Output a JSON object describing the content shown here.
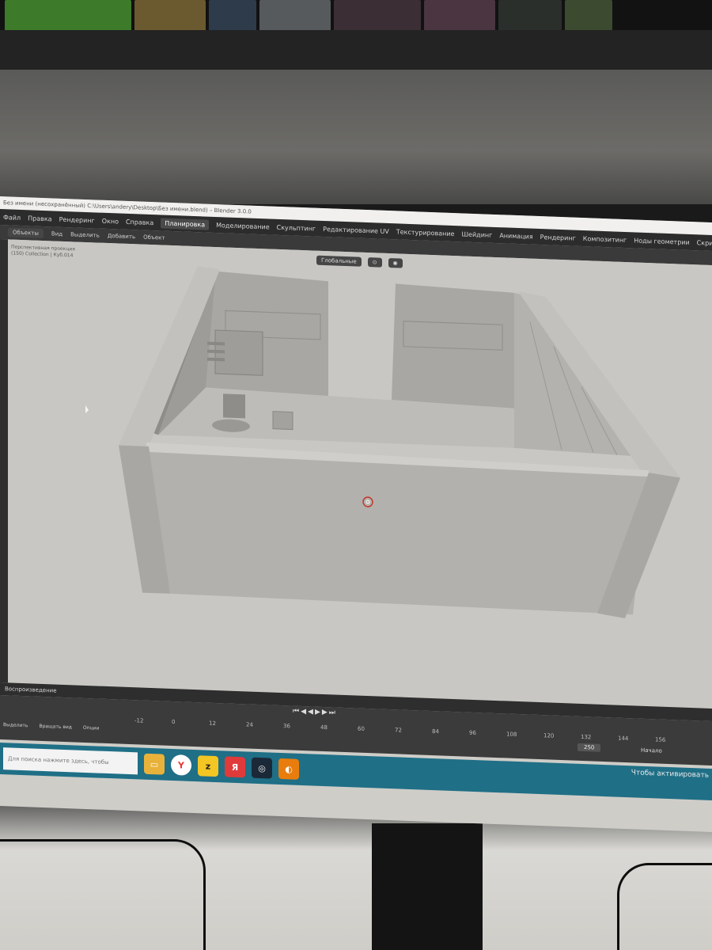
{
  "window": {
    "title": "Без имени (несохранённый) C:\\Users\\andery\\Desktop\\Без имени.blend) – Blender 3.0.0"
  },
  "menus": [
    "Файл",
    "Правка",
    "Рендеринг",
    "Окно",
    "Справка"
  ],
  "workspace_tabs": [
    {
      "label": "Планировка",
      "active": true
    },
    {
      "label": "Моделирование",
      "active": false
    },
    {
      "label": "Скульптинг",
      "active": false
    },
    {
      "label": "Редактирование UV",
      "active": false
    },
    {
      "label": "Текстурирование",
      "active": false
    },
    {
      "label": "Шейдинг",
      "active": false
    },
    {
      "label": "Анимация",
      "active": false
    },
    {
      "label": "Рендеринг",
      "active": false
    },
    {
      "label": "Композитинг",
      "active": false
    },
    {
      "label": "Ноды геометрии",
      "active": false
    },
    {
      "label": "Скриптинг",
      "active": false
    }
  ],
  "toolbar": {
    "mode": "Объекты",
    "items": [
      "Вид",
      "Выделить",
      "Добавить",
      "Объект"
    ]
  },
  "viewport_header": {
    "orientation": "Глобальные"
  },
  "viewport": {
    "view_name": "Перспективная проекция",
    "collection": "(150) Collection | Куб.014"
  },
  "timeline": {
    "playback_label": "Воспроизведение",
    "ticks": [
      "-12",
      "0",
      "12",
      "24",
      "36",
      "48",
      "60",
      "72",
      "84",
      "96",
      "108",
      "120",
      "132",
      "144",
      "156"
    ],
    "current_frame": "250",
    "start_label": "Начало"
  },
  "statusbar": {
    "items": [
      "Выделить",
      "Вращать вид",
      "Опции"
    ]
  },
  "taskbar": {
    "search_placeholder": "Для поиска нажмите здесь, чтобы",
    "activate_windows": "Чтобы активировать"
  },
  "colors": {
    "taskbar": "#1f6f86",
    "viewport": "#c9c7c3",
    "ui_dark": "#2c2c2c"
  }
}
